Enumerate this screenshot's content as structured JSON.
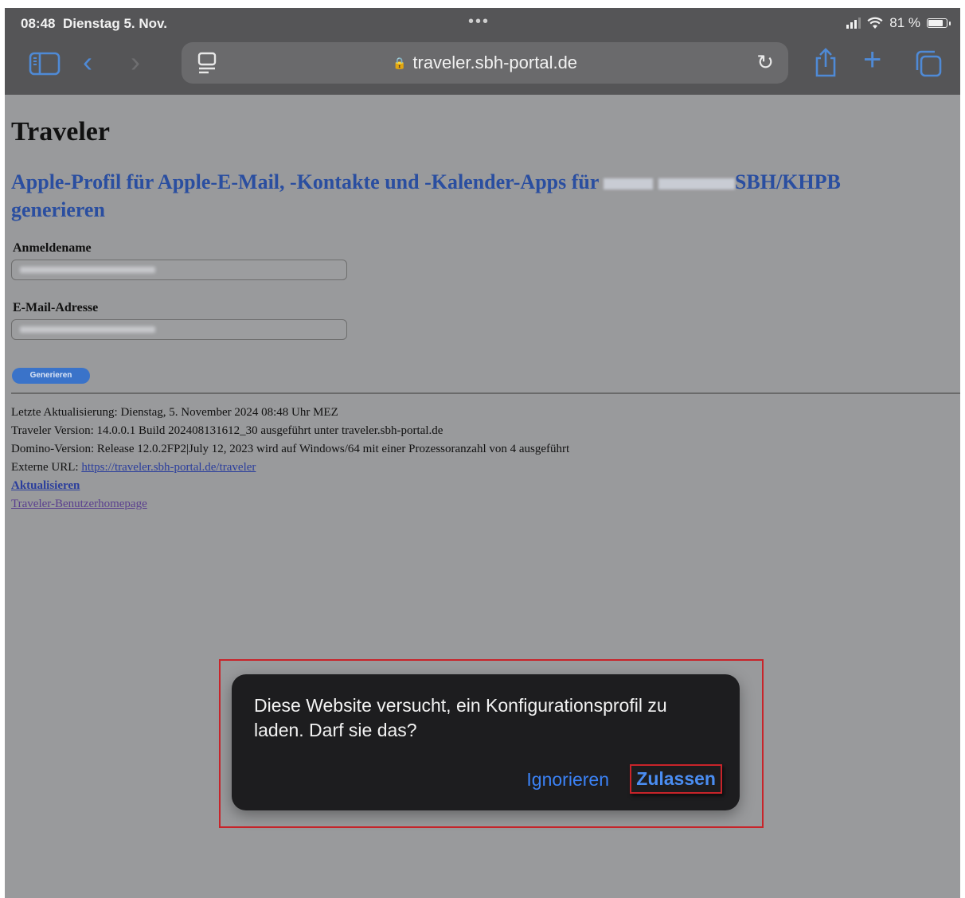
{
  "status_bar": {
    "time": "08:48",
    "date": "Dienstag 5. Nov.",
    "center_dots": "•••",
    "battery": "81 %"
  },
  "toolbar": {
    "url": "traveler.sbh-portal.de",
    "icons": [
      "sidebar-icon",
      "back-icon",
      "forward-icon",
      "reader-icon",
      "lock-icon",
      "reload-icon",
      "share-icon",
      "plus-icon",
      "tabs-icon"
    ]
  },
  "page": {
    "title": "Traveler",
    "heading_prefix": "Apple-Profil für Apple-E-Mail, -Kontakte und -Kalender-Apps für",
    "heading_suffix": "SBH/KHPB",
    "heading_line2": "generieren",
    "login_label": "Anmeldename",
    "email_label": "E-Mail-Adresse",
    "generate_button": "Generieren",
    "info": {
      "last_update": "Letzte Aktualisierung: Dienstag, 5. November 2024 08:48 Uhr MEZ",
      "traveler_version": "Traveler Version: 14.0.0.1 Build 202408131612_30 ausgeführt unter traveler.sbh-portal.de",
      "domino_version": "Domino-Version: Release 12.0.2FP2|July 12, 2023 wird auf Windows/64 mit einer Prozessoranzahl von 4 ausgeführt",
      "external_url_label": "Externe URL: ",
      "external_url": "https://traveler.sbh-portal.de/traveler",
      "refresh_link": "Aktualisieren",
      "homepage_link": "Traveler-Benutzerhomepage"
    }
  },
  "dialog": {
    "message": "Diese Website versucht, ein Konfigurationsprofil zu laden. Darf sie das?",
    "ignore_button": "Ignorieren",
    "allow_button": "Zulassen"
  },
  "colors": {
    "accent": "#3b82f6",
    "heading": "#2a4ea0",
    "highlight": "#c8242a",
    "overlay_background": "#999a9c"
  }
}
